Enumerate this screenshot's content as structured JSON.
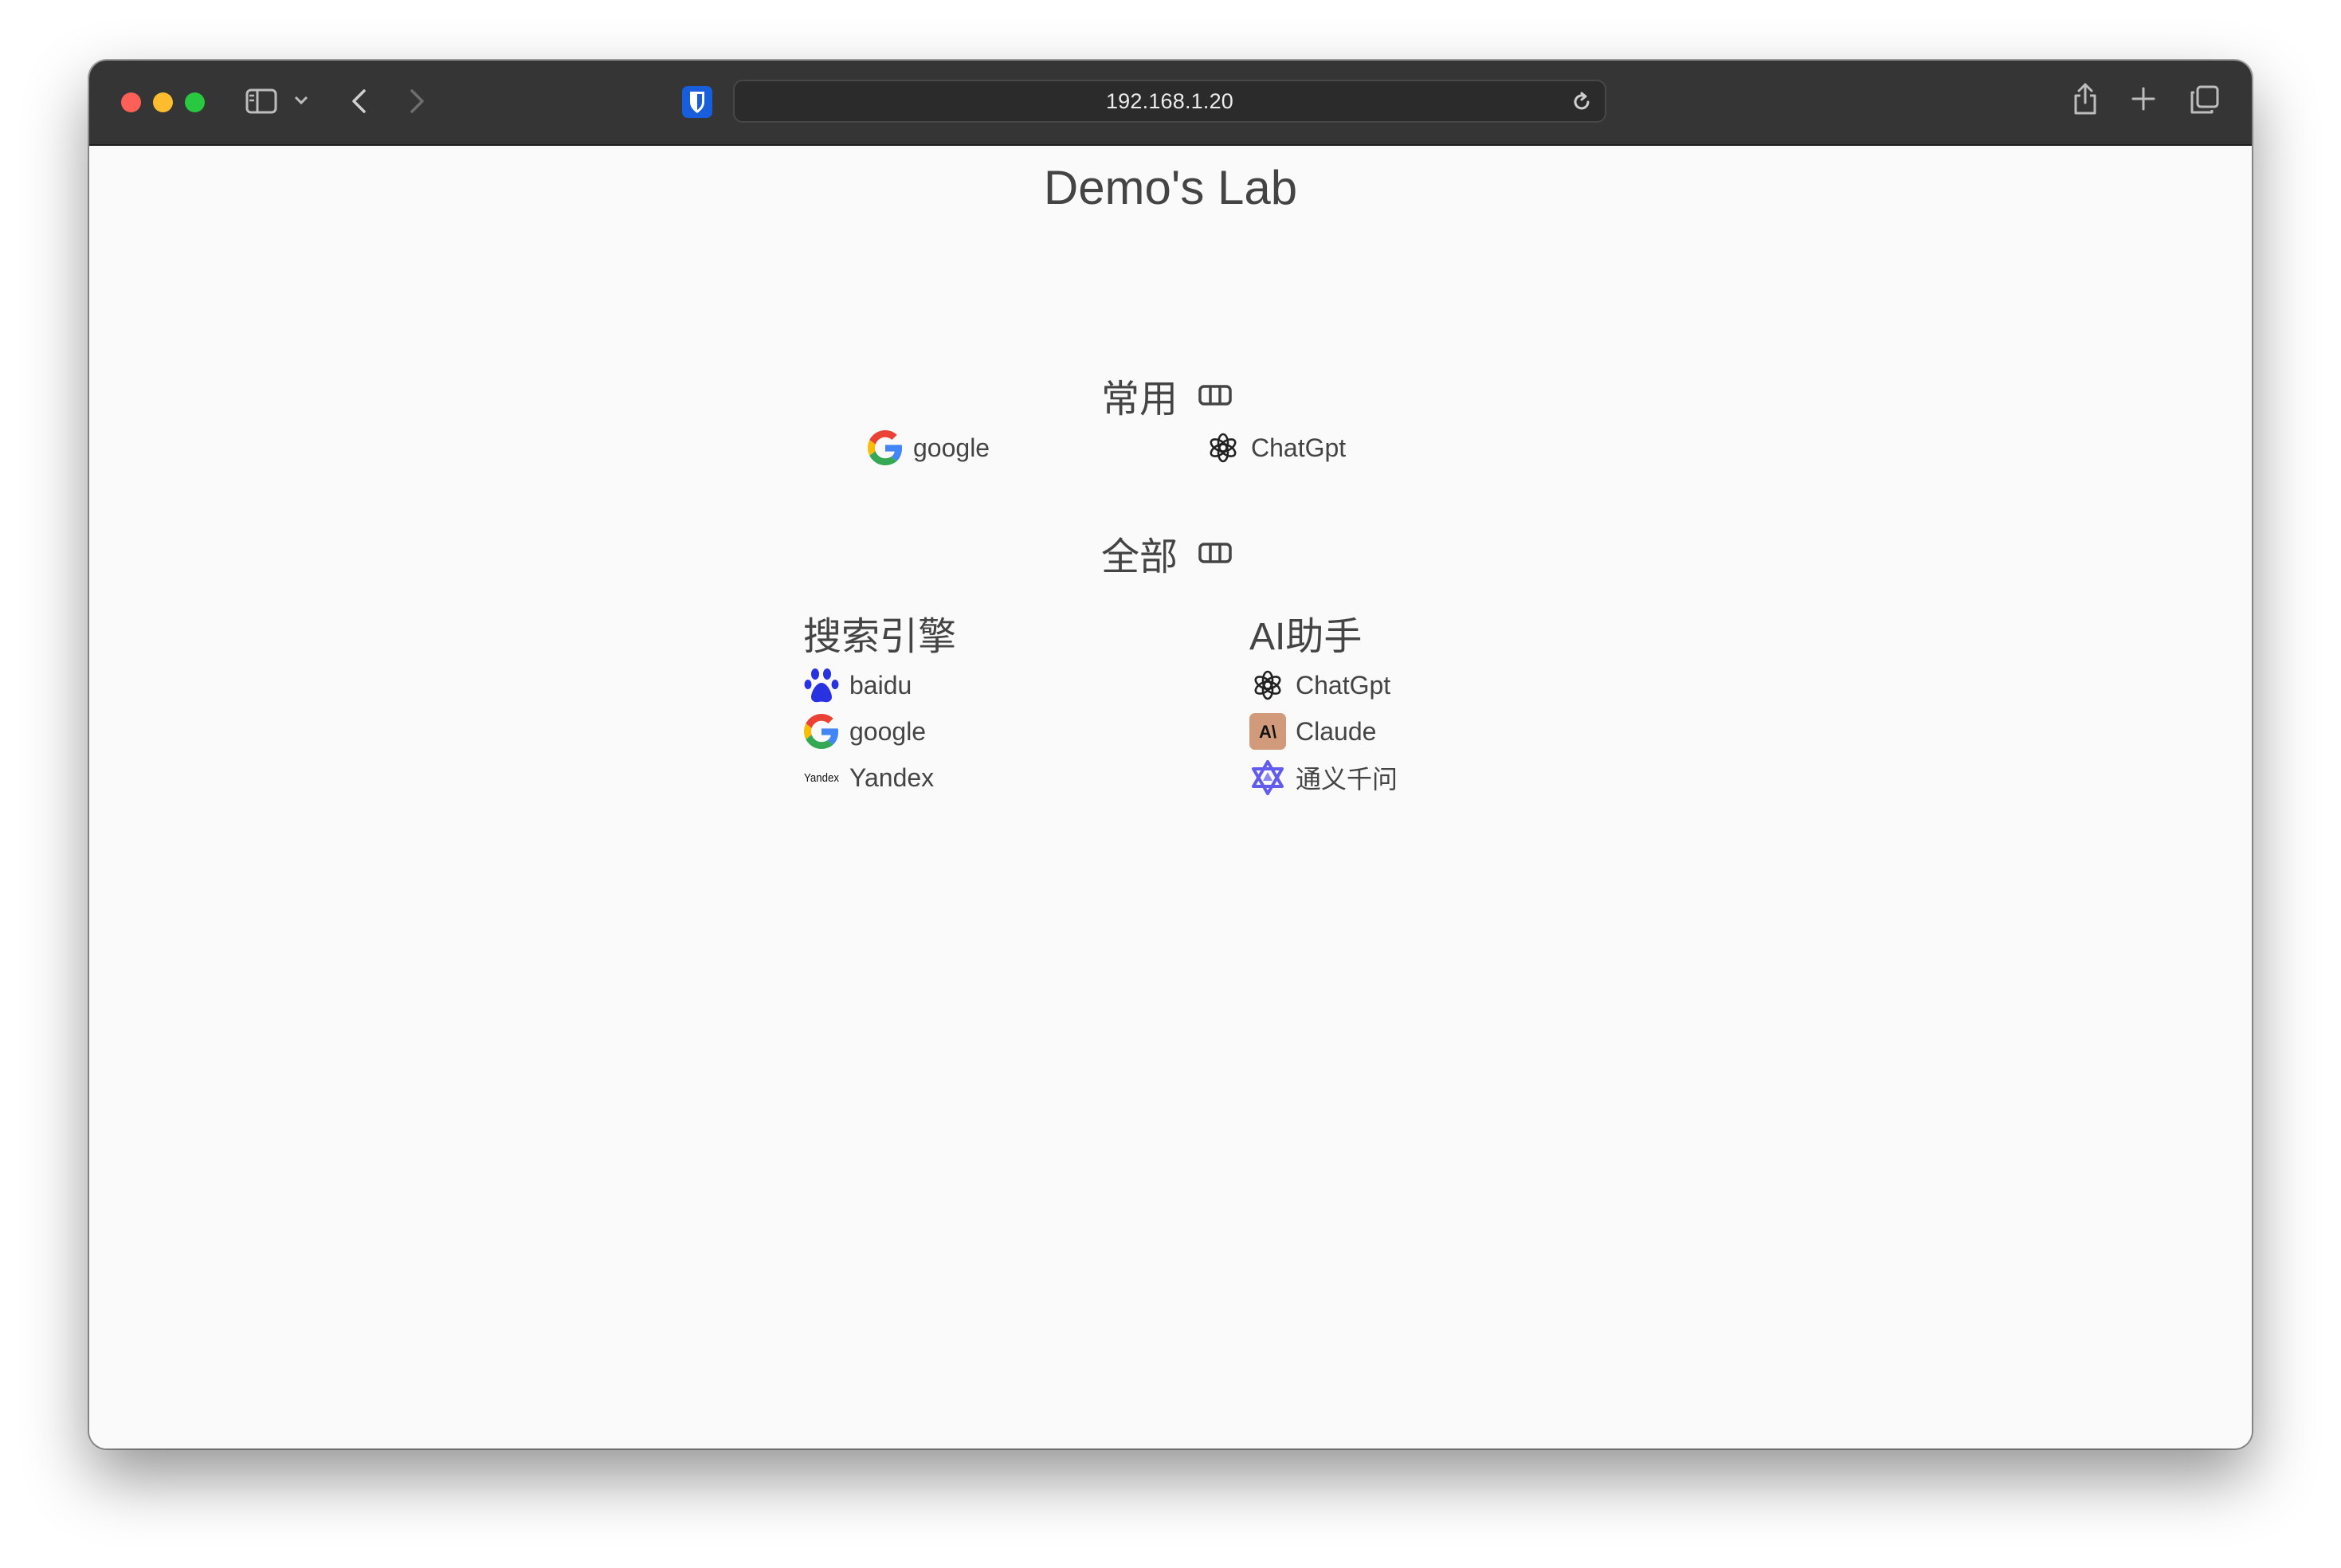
{
  "browser": {
    "url": "192.168.1.20",
    "icons": [
      "sidebar-icon",
      "chevron-down-icon",
      "back-icon",
      "forward-icon",
      "bitwarden-icon",
      "reload-icon",
      "share-icon",
      "new-tab-icon",
      "tab-overview-icon"
    ]
  },
  "page": {
    "title": "Demo's Lab",
    "favorites": {
      "heading": "常用",
      "links": [
        {
          "label": "google",
          "icon": "google-icon"
        },
        {
          "label": "ChatGpt",
          "icon": "openai-icon"
        }
      ]
    },
    "all": {
      "heading": "全部",
      "categories": [
        {
          "name": "搜索引擎",
          "links": [
            {
              "label": "baidu",
              "icon": "baidu-icon"
            },
            {
              "label": "google",
              "icon": "google-icon"
            },
            {
              "label": "Yandex",
              "icon": "yandex-icon",
              "icon_text": "Yandex"
            }
          ]
        },
        {
          "name": "AI助手",
          "links": [
            {
              "label": "ChatGpt",
              "icon": "openai-icon"
            },
            {
              "label": "Claude",
              "icon": "anthropic-icon",
              "icon_text": "A\\"
            },
            {
              "label": "通义千问",
              "icon": "qwen-icon"
            }
          ]
        }
      ]
    }
  },
  "colors": {
    "toolbar": "#353535",
    "page_background": "#fafafa",
    "text": "#444444",
    "bitwarden": "#175ddc",
    "baidu": "#2932e1",
    "claude_tile": "#d19a7a",
    "qwen": "#615ced"
  }
}
